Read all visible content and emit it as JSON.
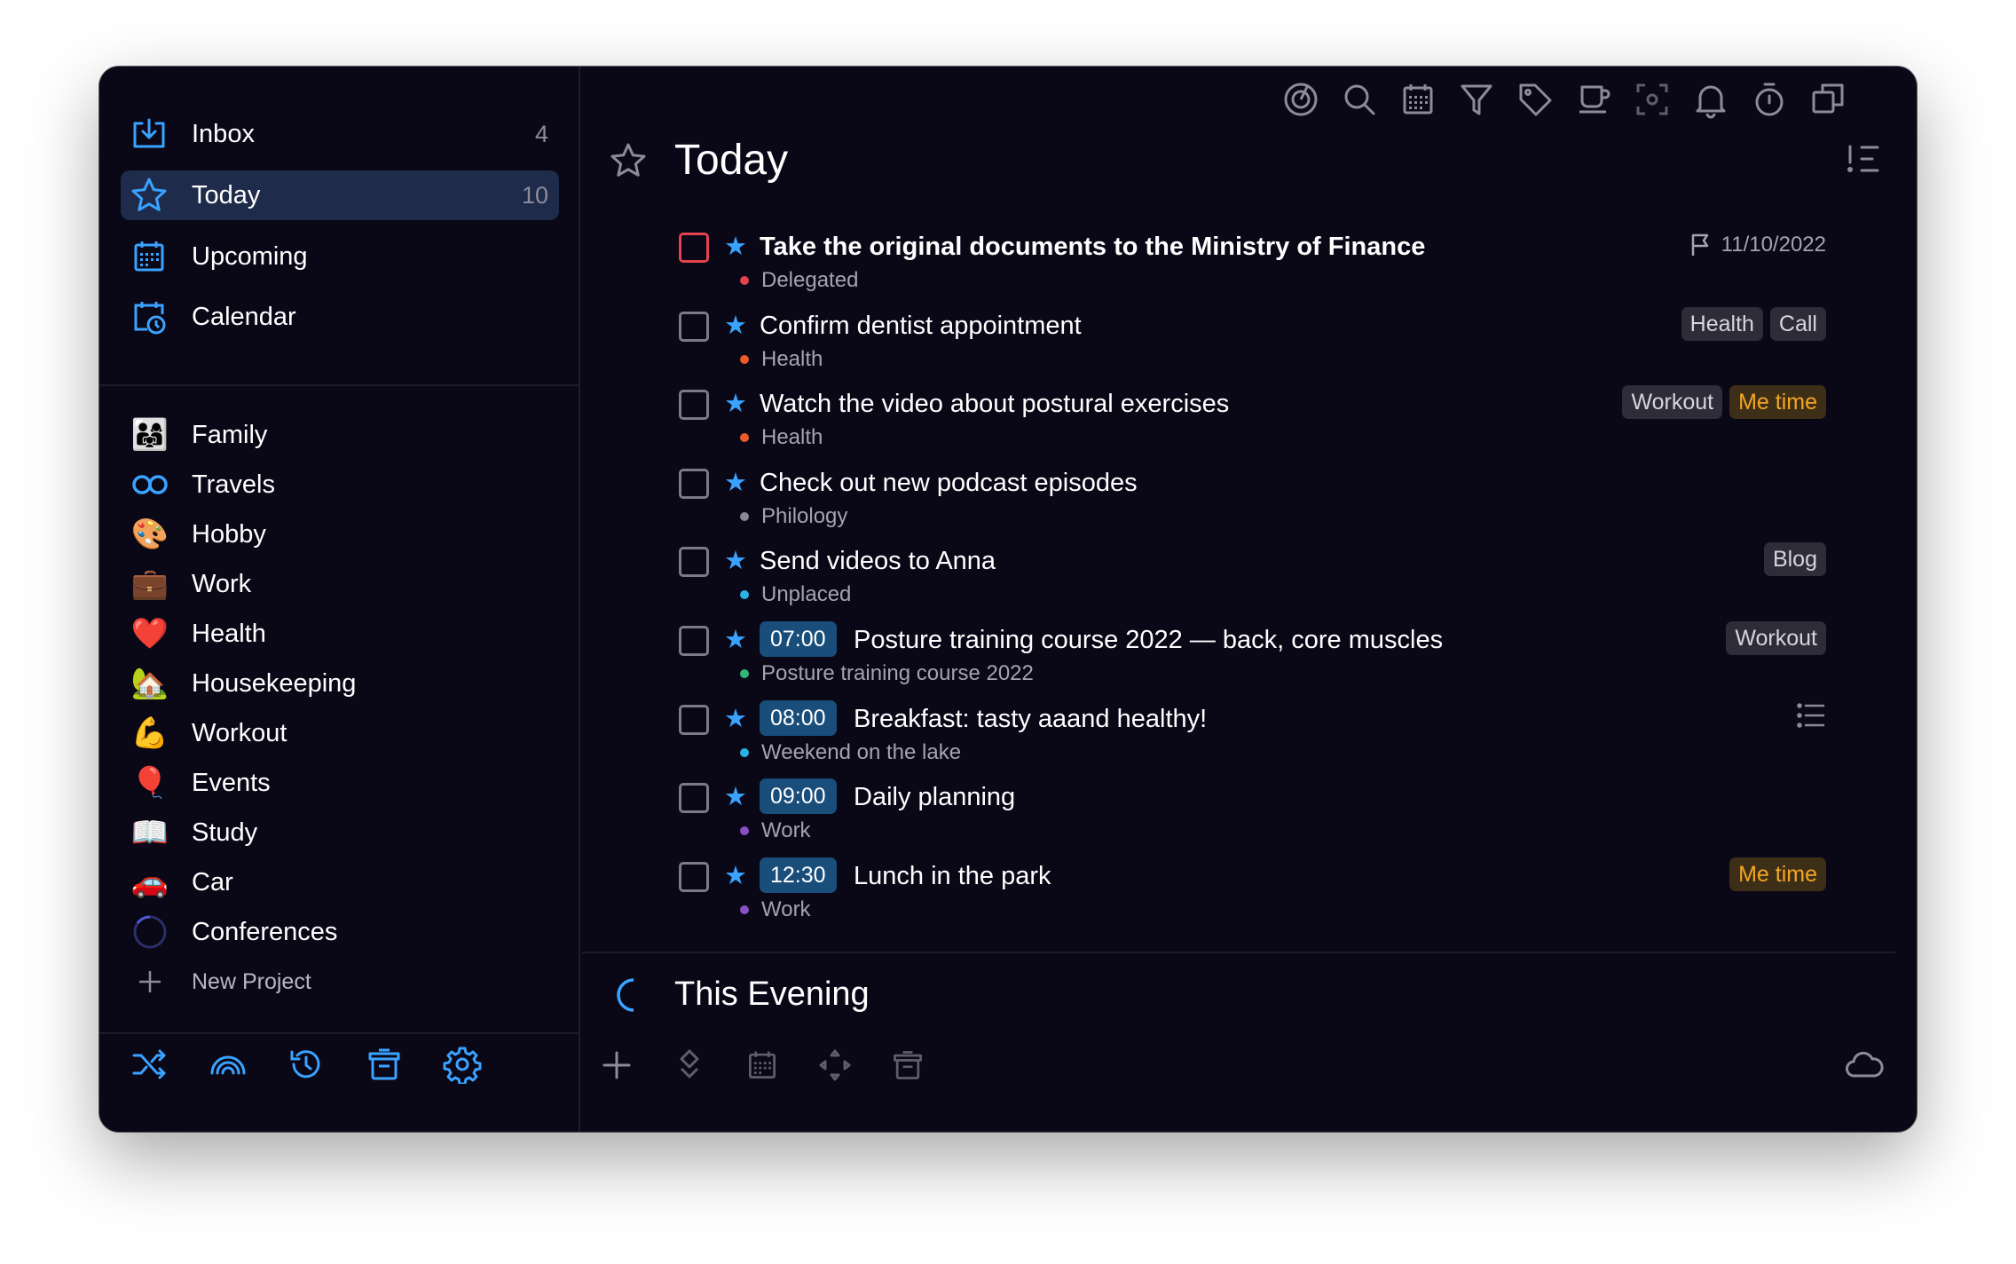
{
  "sidebar": {
    "nav": [
      {
        "label": "Inbox",
        "count": "4",
        "icon": "inbox-icon"
      },
      {
        "label": "Today",
        "count": "10",
        "icon": "star-icon"
      },
      {
        "label": "Upcoming",
        "count": "",
        "icon": "calendar-grid-icon"
      },
      {
        "label": "Calendar",
        "count": "",
        "icon": "calendar-clock-icon"
      }
    ],
    "projects": [
      {
        "label": "Family",
        "emoji": "👨‍👩‍👧"
      },
      {
        "label": "Travels",
        "emoji": "♾️"
      },
      {
        "label": "Hobby",
        "emoji": "🎨"
      },
      {
        "label": "Work",
        "emoji": "💼"
      },
      {
        "label": "Health",
        "emoji": "❤️"
      },
      {
        "label": "Housekeeping",
        "emoji": "🏡"
      },
      {
        "label": "Workout",
        "emoji": "💪"
      },
      {
        "label": "Events",
        "emoji": "🎈"
      },
      {
        "label": "Study",
        "emoji": "📖"
      },
      {
        "label": "Car",
        "emoji": "🚗"
      },
      {
        "label": "Conferences",
        "emoji": "○"
      }
    ],
    "new_project": "New Project",
    "toolbar": [
      "shuffle-icon",
      "rainbow-icon",
      "history-icon",
      "trash-icon",
      "settings-icon"
    ]
  },
  "main": {
    "title": "Today",
    "toolbar": [
      "focus-icon",
      "search-icon",
      "calendar-icon",
      "filter-icon",
      "tag-icon",
      "coffee-icon",
      "scan-icon",
      "bell-icon",
      "timer-icon",
      "duplicate-icon"
    ],
    "tasks": [
      {
        "title": "Take the original documents to the Ministry of Finance",
        "bold": true,
        "time": "",
        "project": "Delegated",
        "project_color": "#e3424f",
        "checkbox_color": "red",
        "due": "11/10/2022",
        "tags": []
      },
      {
        "title": "Confirm dentist appointment",
        "bold": false,
        "time": "",
        "project": "Health",
        "project_color": "#f05a28",
        "checkbox_color": "",
        "due": "",
        "tags": [
          {
            "label": "Health",
            "type": ""
          },
          {
            "label": "Call",
            "type": ""
          }
        ]
      },
      {
        "title": "Watch the video about postural exercises",
        "bold": false,
        "time": "",
        "project": "Health",
        "project_color": "#f05a28",
        "checkbox_color": "",
        "due": "",
        "tags": [
          {
            "label": "Workout",
            "type": ""
          },
          {
            "label": "Me time",
            "type": "metime"
          }
        ]
      },
      {
        "title": "Check out new podcast episodes",
        "bold": false,
        "time": "",
        "project": "Philology",
        "project_color": "#8a8896",
        "checkbox_color": "",
        "due": "",
        "tags": []
      },
      {
        "title": "Send videos to Anna",
        "bold": false,
        "time": "",
        "project": "Unplaced",
        "project_color": "#2bb3e6",
        "checkbox_color": "",
        "due": "",
        "tags": [
          {
            "label": "Blog",
            "type": ""
          }
        ]
      },
      {
        "title": "Posture training course 2022 — back, core muscles",
        "bold": false,
        "time": "07:00",
        "project": "Posture training course 2022",
        "project_color": "#2fb87a",
        "checkbox_color": "",
        "due": "",
        "tags": [
          {
            "label": "Workout",
            "type": ""
          }
        ]
      },
      {
        "title": "Breakfast: tasty aaand healthy!",
        "bold": false,
        "time": "08:00",
        "project": "Weekend on the lake",
        "project_color": "#2bb3e6",
        "checkbox_color": "",
        "due": "",
        "tags": [],
        "checklist": true
      },
      {
        "title": "Daily planning",
        "bold": false,
        "time": "09:00",
        "project": "Work",
        "project_color": "#8a4fc4",
        "checkbox_color": "",
        "due": "",
        "tags": []
      },
      {
        "title": "Lunch in the park",
        "bold": false,
        "time": "12:30",
        "project": "Work",
        "project_color": "#8a4fc4",
        "checkbox_color": "",
        "due": "",
        "tags": [
          {
            "label": "Me time",
            "type": "metime"
          }
        ]
      }
    ],
    "evening_title": "This Evening",
    "bottom_toolbar": [
      "add-icon",
      "reorder-icon",
      "calendar-icon",
      "move-icon",
      "trash-icon",
      "cloud-icon"
    ]
  },
  "colors": {
    "accent": "#3aa3ff",
    "background": "#0a0717",
    "active": "#1f2b4a",
    "metime": "#f4a623"
  }
}
